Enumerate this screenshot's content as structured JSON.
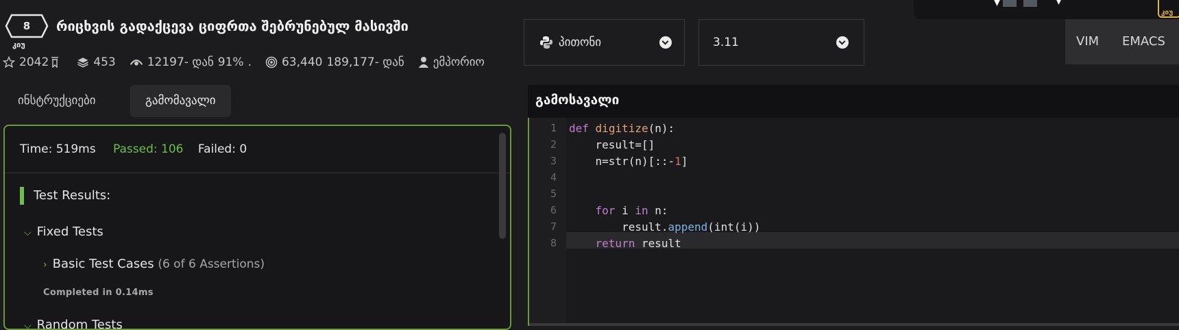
{
  "kata": {
    "rank_number": "8",
    "rank_label": "კიუ",
    "title": "რიცხვის გადაქცევა ციფრთა შებრუნებულ მასივში"
  },
  "stats": {
    "stars": "2042",
    "collections": "453",
    "completed": "12197- დან",
    "satisfaction": "91%",
    "satisfaction_suffix": ".",
    "attempts": "63,440",
    "attempts_total": "189,177- დან",
    "author": "ემპორიო"
  },
  "tabs": {
    "instructions": "ინსტრუქციები",
    "output": "გამომავალი"
  },
  "results": {
    "time": "Time: 519ms",
    "passed": "Passed: 106",
    "failed": "Failed: 0",
    "heading": "Test Results:",
    "group_fixed": "Fixed Tests",
    "basic_label": "Basic Test Cases",
    "basic_detail": "(6 of 6 Assertions)",
    "completed_in": "Completed in 0.14ms",
    "group_random": "Random Tests"
  },
  "language": {
    "label": "პითონი",
    "version": "3.11"
  },
  "editor_modes": [
    "VIM",
    "EMACS"
  ],
  "solution": {
    "title": "გამოსავალი",
    "active_line": 8,
    "line_numbers": [
      "1",
      "2",
      "3",
      "4",
      "5",
      "6",
      "7",
      "8"
    ]
  },
  "top_right": {
    "rank_label": "კიუ"
  },
  "colors": {
    "accent_green": "#6cbf4a",
    "panel_border": "#6a9a3a",
    "rank_gold": "#e3b341"
  },
  "icons": [
    "star-icon",
    "layers-icon",
    "eye-icon",
    "target-icon",
    "user-icon",
    "python-icon",
    "chevron-down-icon",
    "chevron-right-icon"
  ]
}
